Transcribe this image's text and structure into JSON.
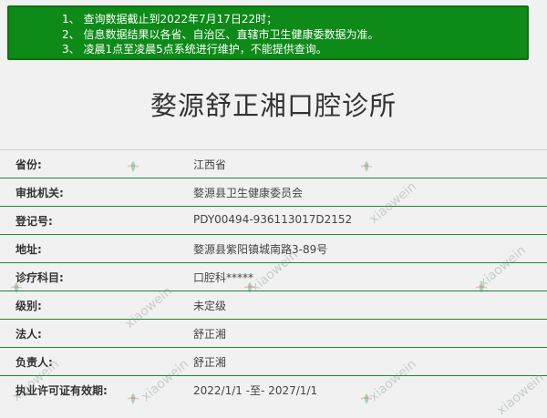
{
  "notice": {
    "lines": [
      "1、 查询数据截止到2022年7月17日22时；",
      "2、 信息数据结果以各省、自治区、直辖市卫生健康委数据为准。",
      "3、 凌晨1点至凌晨5点系统进行维护，不能提供查询。"
    ]
  },
  "title": "婺源舒正湘口腔诊所",
  "rows": [
    {
      "label": "省份:",
      "value": "江西省"
    },
    {
      "label": "审批机关:",
      "value": "婺源县卫生健康委员会"
    },
    {
      "label": "登记号:",
      "value": "PDY00494-936113017D2152"
    },
    {
      "label": "地址:",
      "value": "婺源县紫阳镇城南路3-89号"
    },
    {
      "label": "诊疗科目:",
      "value": "口腔科*****"
    },
    {
      "label": "级别:",
      "value": "未定级"
    },
    {
      "label": "法人:",
      "value": "舒正湘"
    },
    {
      "label": "负责人:",
      "value": "舒正湘"
    },
    {
      "label": "执业许可证有效期:",
      "value": "2022/1/1 -至- 2027/1/1"
    }
  ],
  "watermark": "xiaowein",
  "colors": {
    "notice_bg": "#0e8a18",
    "row_divider": "#1e8a2b"
  }
}
